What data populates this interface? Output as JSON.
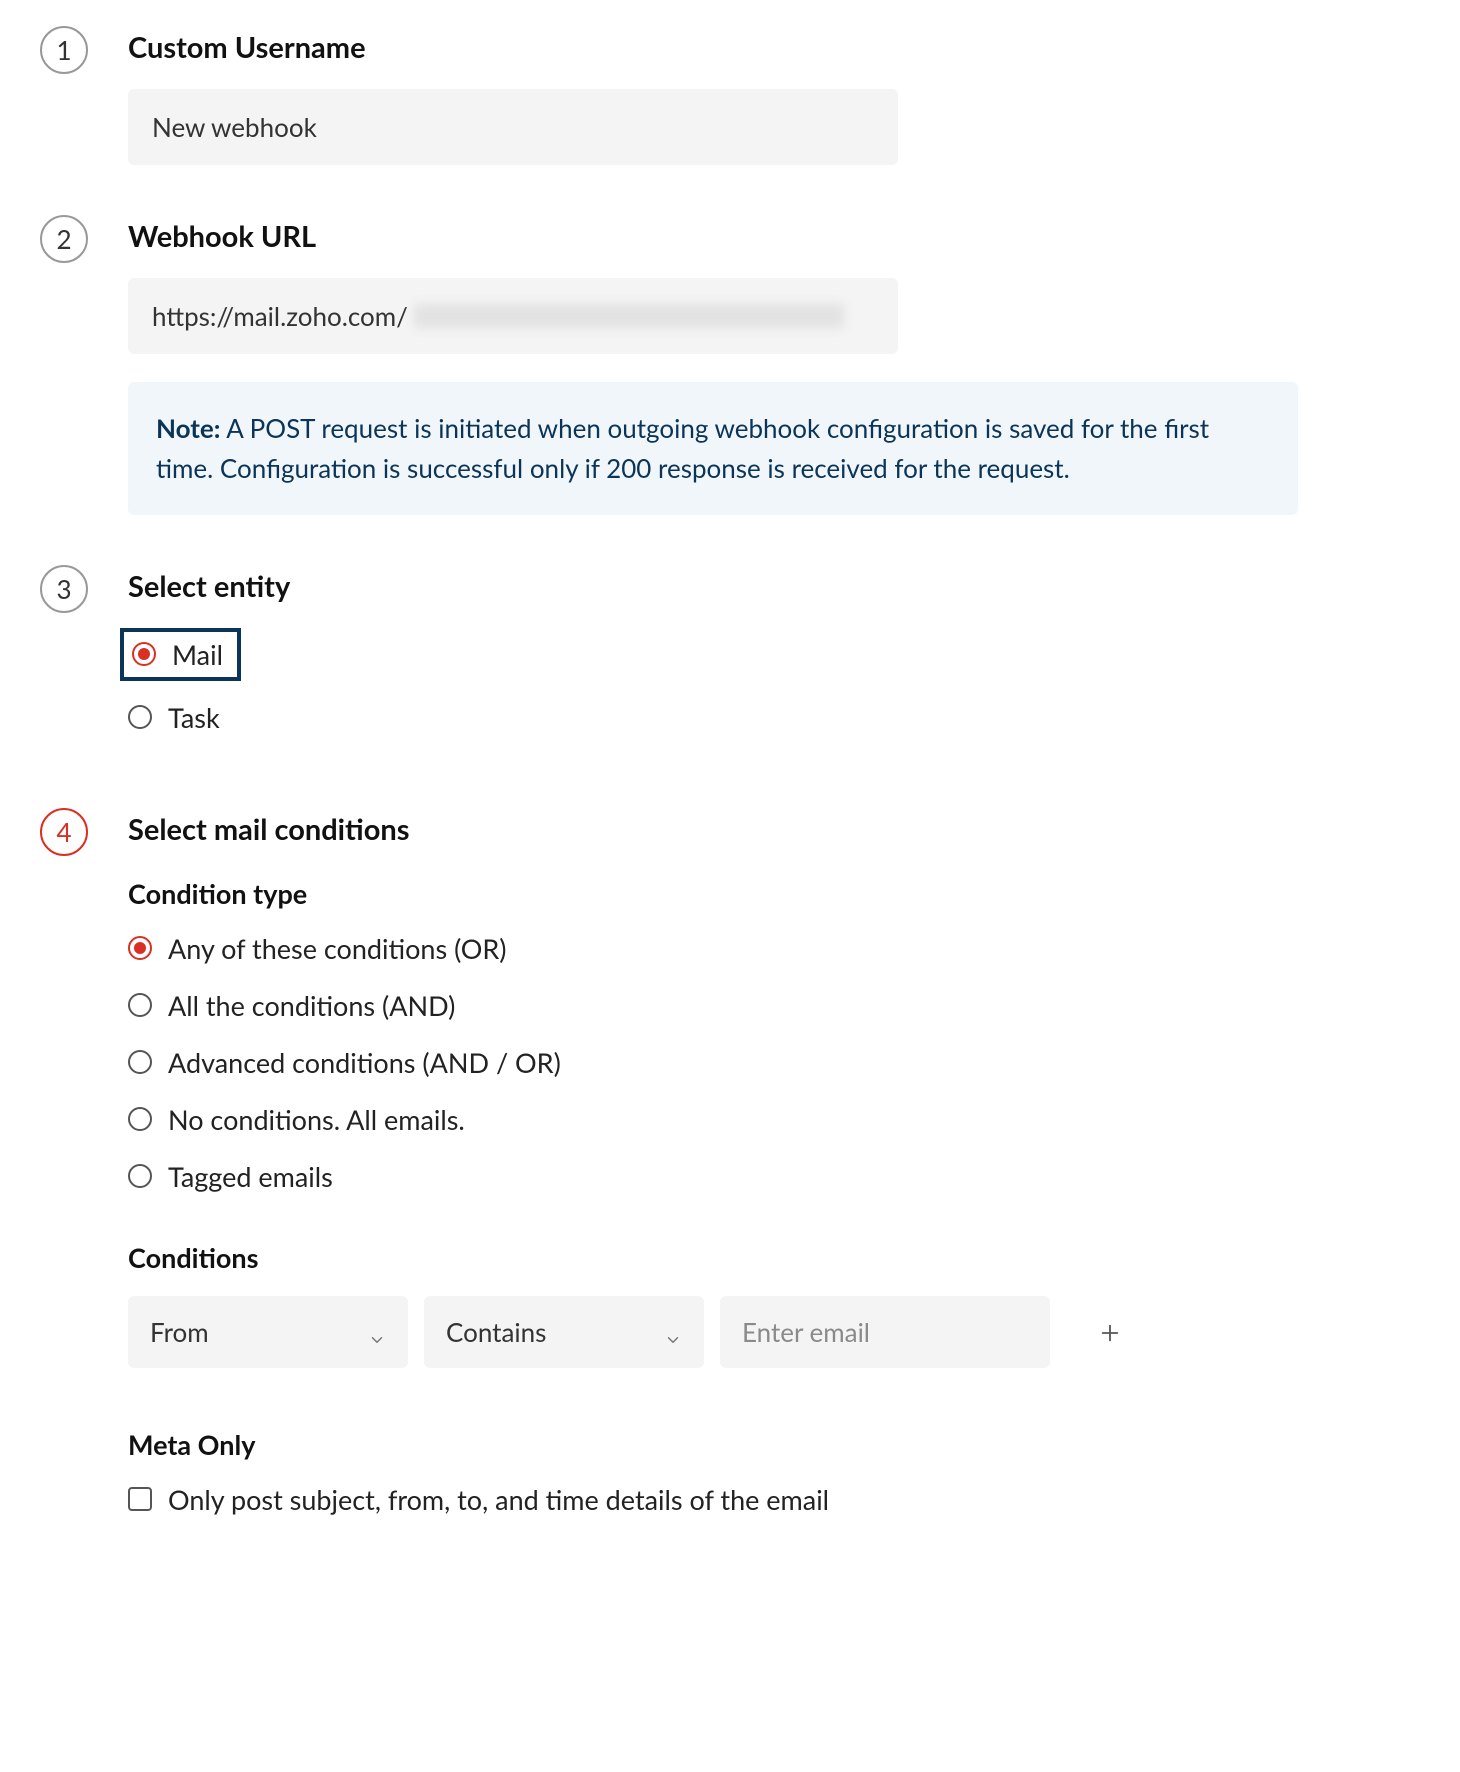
{
  "steps": {
    "s1": {
      "num": "1",
      "title": "Custom Username",
      "value": "New webhook"
    },
    "s2": {
      "num": "2",
      "title": "Webhook URL",
      "url_prefix": "https://mail.zoho.com/",
      "note_label": "Note:",
      "note_text": " A POST request is initiated when outgoing webhook configuration is saved for the first time. Configuration is successful only if 200 response is received for the request."
    },
    "s3": {
      "num": "3",
      "title": "Select entity",
      "options": {
        "mail": "Mail",
        "task": "Task"
      },
      "selected": "mail"
    },
    "s4": {
      "num": "4",
      "title": "Select mail conditions",
      "condition_type_label": "Condition type",
      "condition_types": {
        "or": "Any of these conditions (OR)",
        "and": "All the conditions (AND)",
        "adv": "Advanced conditions (AND / OR)",
        "none": "No conditions. All emails.",
        "tagged": "Tagged emails"
      },
      "condition_type_selected": "or",
      "conditions_label": "Conditions",
      "cond_field": "From",
      "cond_op": "Contains",
      "cond_value_placeholder": "Enter email",
      "meta_only_label": "Meta Only",
      "meta_only_checkbox": "Only post subject, from, to, and time details of the email"
    }
  }
}
